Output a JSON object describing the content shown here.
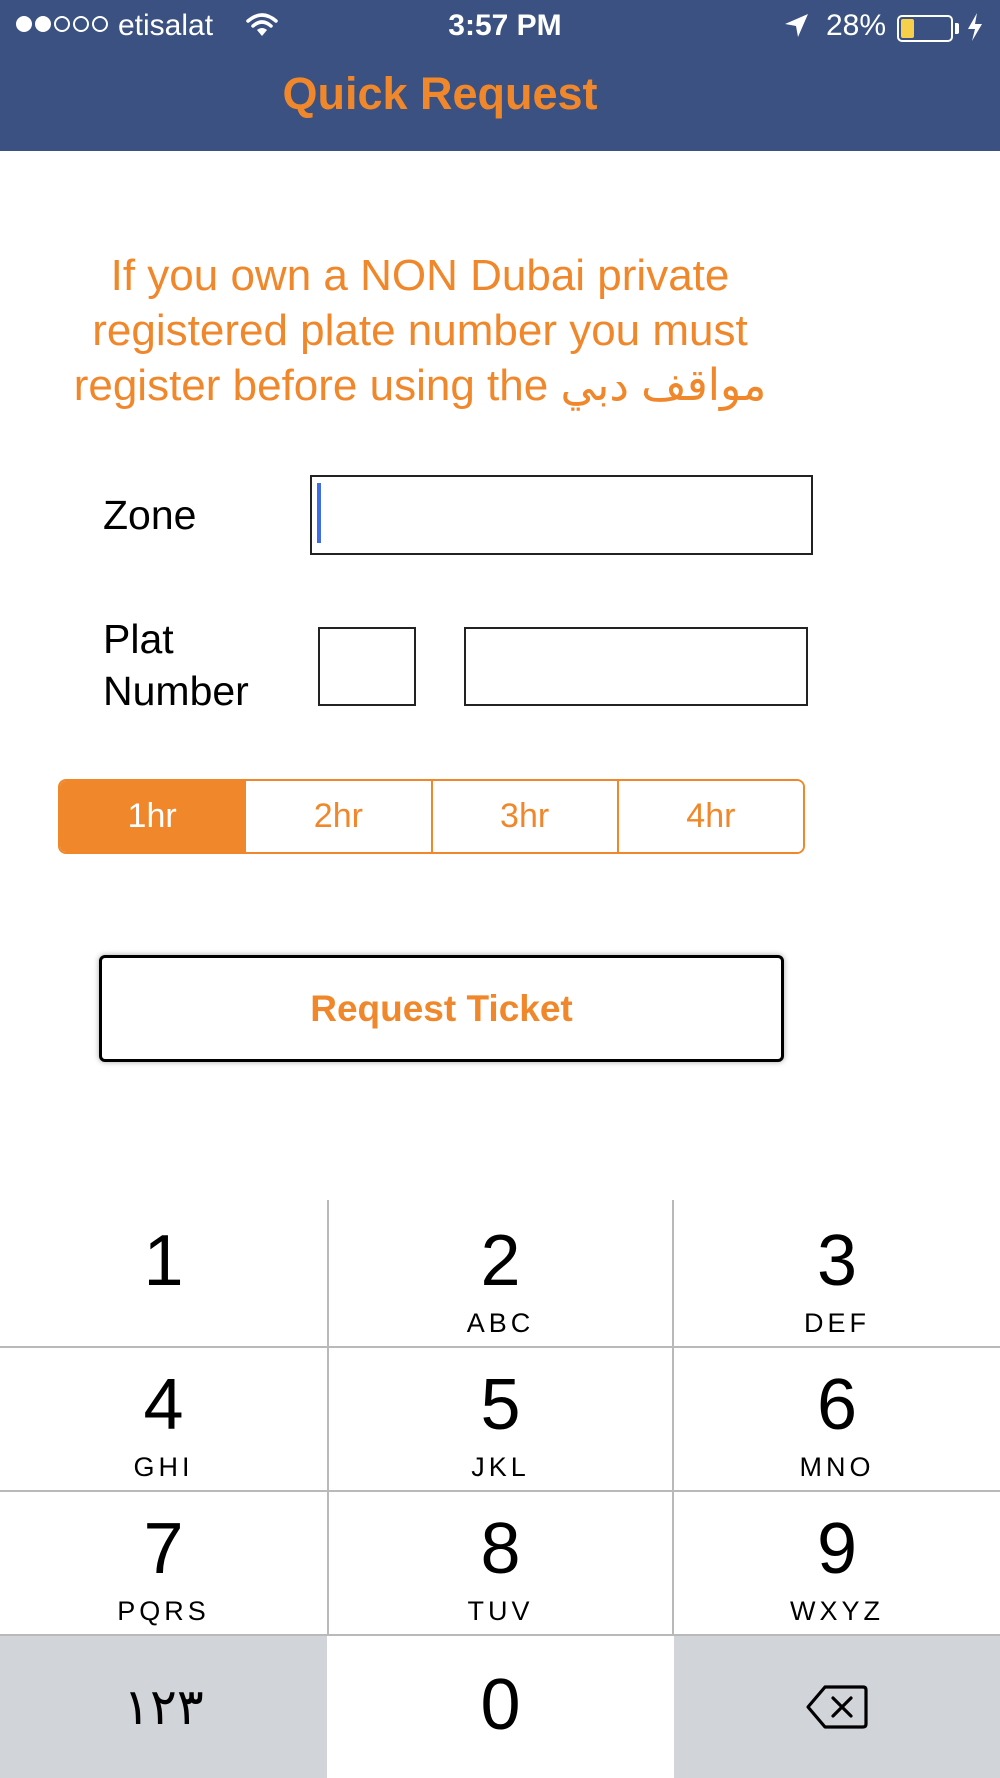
{
  "status_bar": {
    "carrier": "etisalat",
    "time": "3:57 PM",
    "battery_percent": "28%",
    "battery_level": 0.28,
    "signal_bars_filled": 2,
    "signal_bars_total": 5
  },
  "header": {
    "title": "Quick Request"
  },
  "notice": {
    "text": "If you own a NON Dubai private registered plate number you must register before using the مواقف دبي"
  },
  "form": {
    "zone_label": "Zone",
    "zone_value": "",
    "plate_label_line1": "Plat",
    "plate_label_line2": "Number",
    "plate_code_value": "",
    "plate_number_value": ""
  },
  "duration": {
    "options": [
      "1hr",
      "2hr",
      "3hr",
      "4hr"
    ],
    "selected": "1hr"
  },
  "request_button": {
    "label": "Request Ticket"
  },
  "keypad": {
    "keys": [
      {
        "digit": "1",
        "letters": ""
      },
      {
        "digit": "2",
        "letters": "ABC"
      },
      {
        "digit": "3",
        "letters": "DEF"
      },
      {
        "digit": "4",
        "letters": "GHI"
      },
      {
        "digit": "5",
        "letters": "JKL"
      },
      {
        "digit": "6",
        "letters": "MNO"
      },
      {
        "digit": "7",
        "letters": "PQRS"
      },
      {
        "digit": "8",
        "letters": "TUV"
      },
      {
        "digit": "9",
        "letters": "WXYZ"
      }
    ],
    "symbols_key": "١٢٣",
    "zero_key": "0",
    "delete_icon": "backspace-icon"
  },
  "colors": {
    "nav_background": "#3a5181",
    "accent_orange": "#f0882b",
    "caret_blue": "#3f6de8",
    "keypad_gray": "#d1d4d9"
  }
}
